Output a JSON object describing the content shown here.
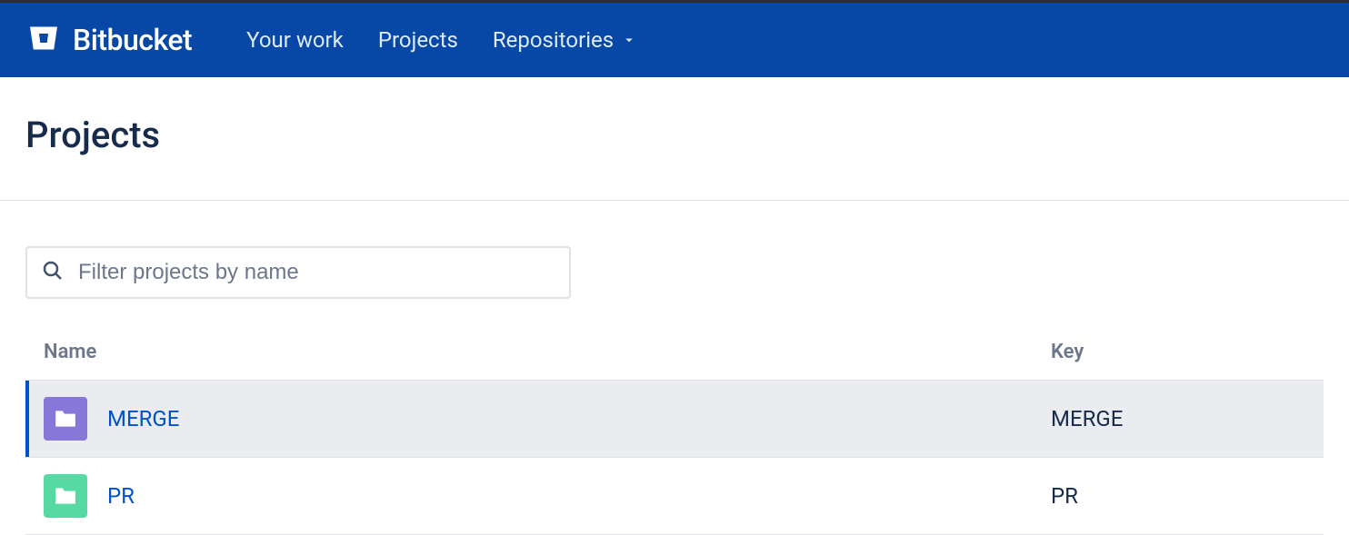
{
  "header": {
    "product_name": "Bitbucket",
    "nav": {
      "your_work": "Your work",
      "projects": "Projects",
      "repositories": "Repositories"
    }
  },
  "page": {
    "title": "Projects"
  },
  "search": {
    "placeholder": "Filter projects by name"
  },
  "table": {
    "columns": {
      "name": "Name",
      "key": "Key"
    },
    "rows": [
      {
        "name": "MERGE",
        "key": "MERGE",
        "icon_color": "purple",
        "selected": true
      },
      {
        "name": "PR",
        "key": "PR",
        "icon_color": "green",
        "selected": false
      }
    ]
  }
}
